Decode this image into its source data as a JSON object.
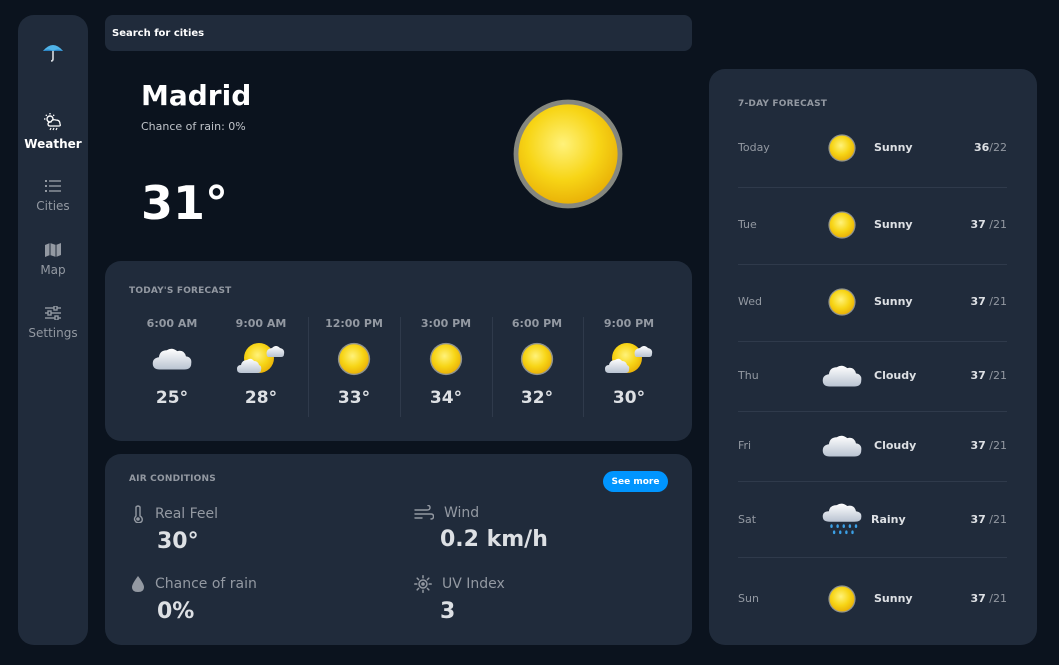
{
  "sidebar": {
    "logo_icon": "umbrella-icon",
    "items": [
      {
        "label": "Weather",
        "icon": "weather-icon",
        "active": true
      },
      {
        "label": "Cities",
        "icon": "list-icon"
      },
      {
        "label": "Map",
        "icon": "map-icon"
      },
      {
        "label": "Settings",
        "icon": "sliders-icon"
      }
    ]
  },
  "search": {
    "placeholder": "Search for cities",
    "value": ""
  },
  "current": {
    "city": "Madrid",
    "rain_chance": "Chance of rain: 0%",
    "temperature": "31°",
    "icon": "sun-icon"
  },
  "today": {
    "title": "TODAY'S FORECAST",
    "hours": [
      {
        "time": "6:00 AM",
        "icon": "cloud-icon",
        "temp": "25°"
      },
      {
        "time": "9:00 AM",
        "icon": "partly-cloudy-icon",
        "temp": "28°"
      },
      {
        "time": "12:00 PM",
        "icon": "sun-icon",
        "temp": "33°"
      },
      {
        "time": "3:00 PM",
        "icon": "sun-icon",
        "temp": "34°"
      },
      {
        "time": "6:00 PM",
        "icon": "sun-icon",
        "temp": "32°"
      },
      {
        "time": "9:00 PM",
        "icon": "partly-cloudy-icon",
        "temp": "30°"
      }
    ]
  },
  "air": {
    "title": "AIR CONDITIONS",
    "see_more": "See more",
    "metrics": [
      {
        "label": "Real Feel",
        "value": "30°",
        "icon": "thermometer-icon"
      },
      {
        "label": "Wind",
        "value": "0.2 km/h",
        "icon": "wind-icon"
      },
      {
        "label": "Chance of rain",
        "value": "0%",
        "icon": "droplet-icon"
      },
      {
        "label": "UV Index",
        "value": "3",
        "icon": "sun-outline-icon"
      }
    ]
  },
  "week": {
    "title": "7-DAY FORECAST",
    "days": [
      {
        "day": "Today",
        "icon": "sun-icon",
        "condition": "Sunny",
        "high": "36",
        "low": "/22"
      },
      {
        "day": "Tue",
        "icon": "sun-icon",
        "condition": "Sunny",
        "high": "37",
        "low": "/21"
      },
      {
        "day": "Wed",
        "icon": "sun-icon",
        "condition": "Sunny",
        "high": "37",
        "low": "/21"
      },
      {
        "day": "Thu",
        "icon": "cloud-icon",
        "condition": "Cloudy",
        "high": "37",
        "low": "/21"
      },
      {
        "day": "Fri",
        "icon": "cloud-icon",
        "condition": "Cloudy",
        "high": "37",
        "low": "/21"
      },
      {
        "day": "Sat",
        "icon": "rain-cloud-icon",
        "condition": "Rainy",
        "high": "37",
        "low": "/21"
      },
      {
        "day": "Sun",
        "icon": "sun-icon",
        "condition": "Sunny",
        "high": "37",
        "low": "/21"
      }
    ]
  },
  "colors": {
    "background": "#0b131e",
    "card": "#202b3b",
    "accent": "#0095ff",
    "sun": "#f5c90f",
    "muted_text": "#9399a2"
  }
}
